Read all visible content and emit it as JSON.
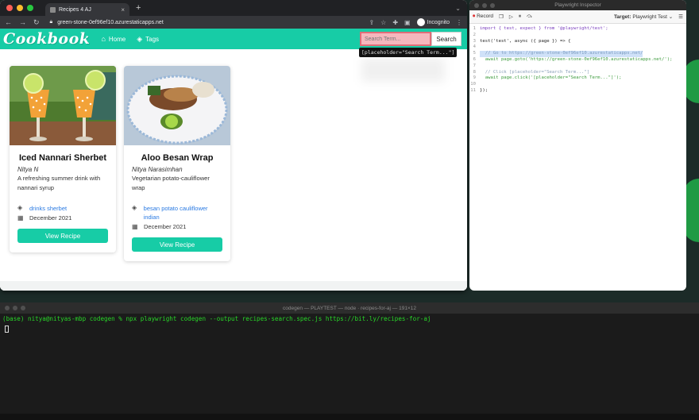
{
  "browser": {
    "tab_title": "Recipes 4 AJ",
    "tab_close": "×",
    "new_tab": "+",
    "url": "green-stone-0ef96ef10.azurestaticapps.net",
    "incognito_label": "Incognito"
  },
  "site": {
    "brand": "Cookbook",
    "nav": [
      {
        "label": "Home",
        "icon": "home-icon"
      },
      {
        "label": "Tags",
        "icon": "tags-icon"
      }
    ],
    "search": {
      "placeholder": "Search Term...",
      "button_label": "Search"
    },
    "tooltip": "[placeholder=\"Search Term...\"]"
  },
  "recipes": [
    {
      "title": "Iced Nannari Sherbet",
      "author": "Nitya N",
      "description": "A refreshing summer drink with nannari syrup",
      "tags": "drinks sherbet",
      "date": "December 2021",
      "button": "View Recipe"
    },
    {
      "title": "Aloo Besan Wrap",
      "author": "Nitya Narasimhan",
      "description": "Vegetarian potato-cauliflower wrap",
      "tags": "besan potato cauliflower indian",
      "date": "December 2021",
      "button": "View Recipe"
    }
  ],
  "inspector": {
    "window_title": "Playwright Inspector",
    "record_label": "Record",
    "target_label": "Target:",
    "target_value": "Playwright Test",
    "code_lines": [
      {
        "n": "1",
        "text": "import { test, expect } from '@playwright/test';"
      },
      {
        "n": "2",
        "text": ""
      },
      {
        "n": "3",
        "text": "test('test', async ({ page }) => {"
      },
      {
        "n": "4",
        "text": ""
      },
      {
        "n": "5",
        "text": "  // Go to https://green-stone-0ef96ef10.azurestaticapps.net/"
      },
      {
        "n": "6",
        "text": "  await page.goto('https://green-stone-0ef96ef10.azurestaticapps.net/');"
      },
      {
        "n": "7",
        "text": ""
      },
      {
        "n": "8",
        "text": "  // Click [placeholder=\"Search Term...\"]"
      },
      {
        "n": "9",
        "text": "  await page.click('[placeholder=\"Search Term...\"]');"
      },
      {
        "n": "10",
        "text": ""
      },
      {
        "n": "11",
        "text": "});"
      }
    ]
  },
  "terminal": {
    "title": "codegen — PLAYTEST — node · recipes-for-aj — 191×12",
    "command": "(base) nitya@nityas-mbp codegen % npx playwright codegen --output recipes-search.spec.js https://bit.ly/recipes-for-aj"
  },
  "colors": {
    "accent": "#17cca6",
    "link": "#2a7ae2",
    "terminal_text": "#28d628"
  }
}
